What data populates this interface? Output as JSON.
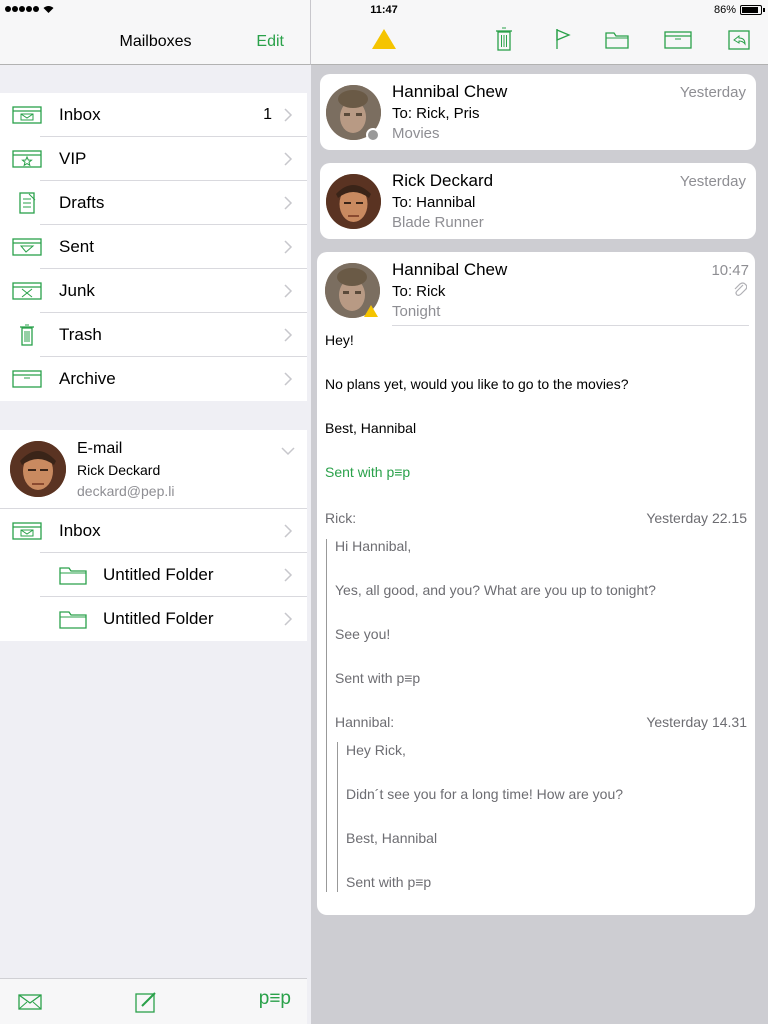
{
  "status": {
    "time": "11:47",
    "battery": "86%"
  },
  "left": {
    "header": {
      "title": "Mailboxes",
      "edit": "Edit"
    },
    "mailboxes": [
      {
        "label": "Inbox",
        "count": "1",
        "icon": "inbox-icon"
      },
      {
        "label": "VIP",
        "count": "",
        "icon": "vip-icon"
      },
      {
        "label": "Drafts",
        "count": "",
        "icon": "drafts-icon"
      },
      {
        "label": "Sent",
        "count": "",
        "icon": "sent-icon"
      },
      {
        "label": "Junk",
        "count": "",
        "icon": "junk-icon"
      },
      {
        "label": "Trash",
        "count": "",
        "icon": "trash-icon"
      },
      {
        "label": "Archive",
        "count": "",
        "icon": "archive-icon"
      }
    ],
    "account": {
      "type": "E-mail",
      "name": "Rick Deckard",
      "email": "deckard@pep.li"
    },
    "account_folders": [
      {
        "label": "Inbox"
      },
      {
        "label": "Untitled Folder"
      },
      {
        "label": "Untitled Folder"
      }
    ],
    "footer": {
      "pep": "p≡p"
    }
  },
  "messages": [
    {
      "from": "Hannibal Chew",
      "date": "Yesterday",
      "to": "To: Rick, Pris",
      "subject": "Movies"
    },
    {
      "from": "Rick Deckard",
      "date": "Yesterday",
      "to": "To: Hannibal",
      "subject": "Blade Runner"
    },
    {
      "from": "Hannibal Chew",
      "date": "10:47",
      "to": "To: Rick",
      "subject": "Tonight"
    }
  ],
  "open_message": {
    "body": [
      "Hey!",
      "No plans yet, would you like to go to the movies?",
      "Best, Hannibal"
    ],
    "signature": "Sent with p≡p",
    "quote1": {
      "author": "Rick:",
      "date": "Yesterday 22.15",
      "lines": [
        "Hi Hannibal,",
        "Yes, all good, and you? What are you up to tonight?",
        "See you!",
        "Sent with p≡p"
      ]
    },
    "quote2": {
      "author": "Hannibal:",
      "date": "Yesterday 14.31",
      "lines": [
        "Hey Rick,",
        "Didn´t see you for a long time! How are you?",
        "Best, Hannibal",
        "Sent with p≡p"
      ]
    }
  },
  "colors": {
    "accent": "#2aa14a",
    "warning": "#f5c400"
  }
}
